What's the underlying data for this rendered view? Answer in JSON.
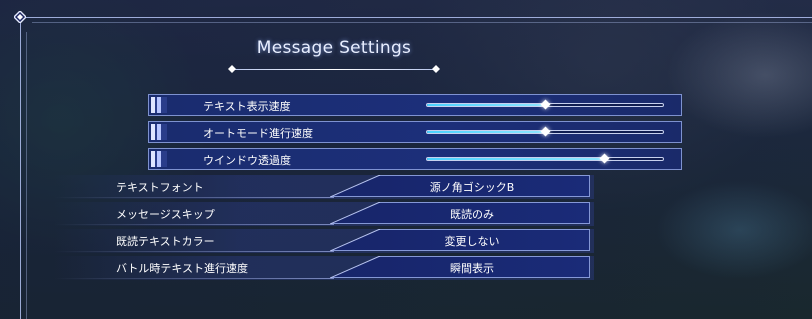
{
  "screen": {
    "title": "Message Settings"
  },
  "sliders": [
    {
      "label": "テキスト表示速度",
      "level": 0.5
    },
    {
      "label": "オートモード進行速度",
      "level": 0.5
    },
    {
      "label": "ウインドウ透過度",
      "level": 0.75
    }
  ],
  "options": [
    {
      "label": "テキストフォント",
      "value": "源ノ角ゴシックB"
    },
    {
      "label": "メッセージスキップ",
      "value": "既読のみ"
    },
    {
      "label": "既読テキストカラー",
      "value": "変更しない"
    },
    {
      "label": "バトル時テキスト進行速度",
      "value": "瞬間表示"
    }
  ],
  "colors": {
    "panel": "#1c2f7a",
    "slider_fill": "#4ad2ff",
    "frame": "#bec dff"
  },
  "icons": {
    "corner": "diamond-gem-icon",
    "title_ornament": "diamond-icon"
  }
}
